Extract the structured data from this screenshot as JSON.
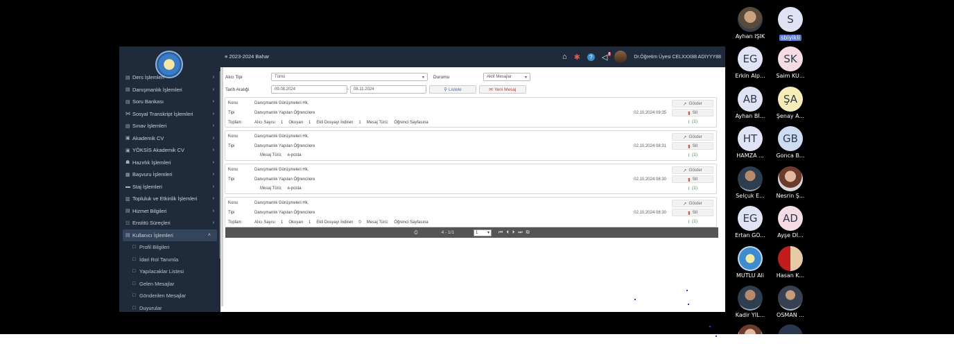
{
  "topbar": {
    "term": "≡ 2023-2024 Bahar",
    "notif_count": "8",
    "user_name": "Dr.Öğretim Üyesi CELXXX88 ADIYYY88"
  },
  "sidebar": {
    "items": [
      {
        "label": "Ders İşlemleri",
        "icon": "list-icon"
      },
      {
        "label": "Danışmanlık İşlemleri",
        "icon": "list-icon"
      },
      {
        "label": "Soru Bankası",
        "icon": "list-icon"
      },
      {
        "label": "Sosyal Transkript İşlemleri",
        "icon": "share-icon"
      },
      {
        "label": "Sınav İşlemleri",
        "icon": "list-icon"
      },
      {
        "label": "Akademik CV",
        "icon": "id-card-icon"
      },
      {
        "label": "YÖKSİS Akademik CV",
        "icon": "id-card-icon"
      },
      {
        "label": "Hazırlık İşlemleri",
        "icon": "group-icon"
      },
      {
        "label": "Başvuru İşlemleri",
        "icon": "clipboard-icon"
      },
      {
        "label": "Staj İşlemleri",
        "icon": "bed-icon"
      },
      {
        "label": "Topluluk ve Etkinlik İşlemleri",
        "icon": "calendar-icon"
      },
      {
        "label": "Hizmet Bilgileri",
        "icon": "list-icon"
      },
      {
        "label": "Enstitü Süreçleri",
        "icon": "users-icon"
      },
      {
        "label": "Kullanıcı İşlemleri",
        "icon": "list-icon"
      }
    ],
    "subitems": [
      "Profil Bilgileri",
      "İdari Rol Tanımla",
      "Yapılacaklar Listesi",
      "Gelen Mesajlar",
      "Gönderilen Mesajlar",
      "Duyurular"
    ]
  },
  "filters": {
    "recipient_type_label": "Alıcı Tipi",
    "recipient_type_value": "Tümü",
    "status_label": "Durumu",
    "status_value": "Aktif Mesajlar",
    "date_range_label": "Tarih Aralığı",
    "date_from": "09.08.2024",
    "date_to": "08.11.2024",
    "list_button": "Listele",
    "new_message_button": "Yeni Mesaj"
  },
  "labels": {
    "subject": "Konu",
    "type": "Tipi",
    "total": "Toplam",
    "recipient_count": "Alıcı Sayısı",
    "reader": "Okuyan",
    "attachment_downloader": "Ekli Dosyayı İndiren",
    "message_type": "Mesaj Türü:",
    "show": "Göster",
    "delete": "Sil",
    "attachment": "(1)"
  },
  "messages": [
    {
      "subject": "Danışmanlık Görüşmeleri Hk.",
      "type": "Danışmanlık Yapılan Öğrencilere",
      "date": "02.10.2024 09:35",
      "recipients": "1",
      "readers": "1",
      "downloaders": "1",
      "message_type": "Öğrenci Sayfasına"
    },
    {
      "subject": "Danışmanlık Görüşmeleri Hk.",
      "type": "Danışmanlık Yapılan Öğrencilere",
      "date": "02.10.2024 08:31",
      "message_type": "e-posta"
    },
    {
      "subject": "Danışmanlık Görüşmeleri Hk.",
      "type": "Danışmanlık Yapılan Öğrencilere",
      "date": "02.10.2024 08:30",
      "message_type": "e-posta"
    },
    {
      "subject": "Danışmanlık Görüşmeleri Hk.",
      "type": "Danışmanlık Yapılan Öğrencilere",
      "date": "02.10.2024 08:30",
      "recipients": "1",
      "readers": "1",
      "downloaders": "0",
      "message_type": "Öğrenci Sayfasına"
    }
  ],
  "pager": {
    "range": "4 - 1/1",
    "page": "1"
  },
  "participants": [
    {
      "initials": "",
      "name": "Ayhan IŞIK",
      "bg": "#3b4a5c"
    },
    {
      "initials": "S",
      "name": "sbiyikli",
      "bg": "#dfe3f3"
    },
    {
      "initials": "EG",
      "name": "Erkin Alp...",
      "bg": "#dfe3f3"
    },
    {
      "initials": "SK",
      "name": "Saim KU...",
      "bg": "#f4dbe4"
    },
    {
      "initials": "AB",
      "name": "Ayhan Bİ...",
      "bg": "#dfe3f3"
    },
    {
      "initials": "ŞA",
      "name": "Şenay A...",
      "bg": "#f6ecb8"
    },
    {
      "initials": "HT",
      "name": "HAMZA ...",
      "bg": "#dfe3f3"
    },
    {
      "initials": "GB",
      "name": "Gonca B...",
      "bg": "#cddcf2"
    },
    {
      "initials": "",
      "name": "Selçuk E...",
      "bg": "#6b5a4a"
    },
    {
      "initials": "",
      "name": "Nesrin Ş...",
      "bg": "#d9c3b0"
    },
    {
      "initials": "EG",
      "name": "Ertan GÖ...",
      "bg": "#dfe3f3"
    },
    {
      "initials": "AD",
      "name": "Ayşe Dİ...",
      "bg": "#f4dbe4"
    },
    {
      "initials": "",
      "name": "MUTLU Ali",
      "bg": "#3e8bd0"
    },
    {
      "initials": "",
      "name": "Hasan K...",
      "bg": "#c21d1d"
    },
    {
      "initials": "",
      "name": "Kadir YIL...",
      "bg": "#2c3e50"
    },
    {
      "initials": "",
      "name": "OSMAN ...",
      "bg": "#374152"
    }
  ]
}
